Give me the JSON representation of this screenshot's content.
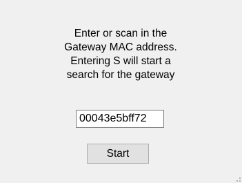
{
  "dialog": {
    "prompt": "Enter or scan in the\nGateway MAC address.\nEntering S will start a\nsearch for the gateway",
    "mac_value": "00043e5bff72",
    "start_label": "Start"
  }
}
